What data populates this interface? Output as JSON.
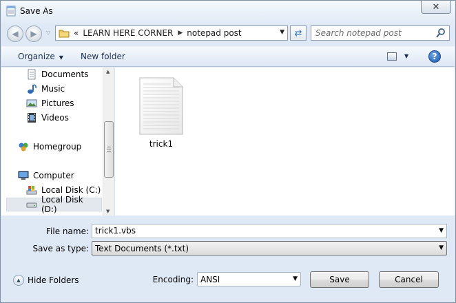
{
  "window": {
    "title": "Save As",
    "close_symbol": "✕"
  },
  "address_bar": {
    "prefix": "«",
    "breadcrumbs": [
      "LEARN HERE CORNER",
      "notepad post"
    ]
  },
  "search": {
    "placeholder": "Search notepad post"
  },
  "toolbar": {
    "organize_label": "Organize",
    "new_folder_label": "New folder",
    "help_label": "?"
  },
  "nav_pane": {
    "items": [
      {
        "label": "Documents",
        "icon": "documents-icon"
      },
      {
        "label": "Music",
        "icon": "music-icon"
      },
      {
        "label": "Pictures",
        "icon": "pictures-icon"
      },
      {
        "label": "Videos",
        "icon": "videos-icon"
      },
      {
        "label": "Homegroup",
        "icon": "homegroup-icon"
      },
      {
        "label": "Computer",
        "icon": "computer-icon"
      },
      {
        "label": "Local Disk (C:)",
        "icon": "drive-c-icon"
      },
      {
        "label": "Local Disk (D:)",
        "icon": "drive-d-icon",
        "selected": true
      }
    ]
  },
  "files": [
    {
      "name": "trick1",
      "icon": "text-document-icon"
    }
  ],
  "form": {
    "file_name_label": "File name:",
    "file_name_value": "trick1.vbs",
    "save_type_label": "Save as type:",
    "save_type_value": "Text Documents (*.txt)",
    "encoding_label": "Encoding:",
    "encoding_value": "ANSI"
  },
  "buttons": {
    "hide_folders": "Hide Folders",
    "save": "Save",
    "cancel": "Cancel"
  },
  "colors": {
    "selection": "#e3e8ee",
    "toolbar_text": "#1e3050",
    "accent": "#2f6fb0"
  }
}
